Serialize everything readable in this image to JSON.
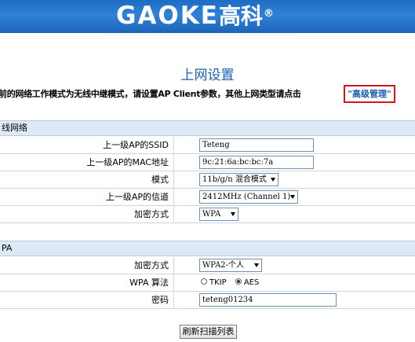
{
  "header": {
    "logo_text": "GAOKE",
    "logo_cn": "高科",
    "logo_mark": "®"
  },
  "page": {
    "title": "上网设置",
    "notice": "前的网络工作模式为无线中继模式，请设置AP Client参数，其他上网类型请点击",
    "advanced_link": "\"高级管理\""
  },
  "section_wireless": {
    "title": "线网络",
    "rows": {
      "ssid": {
        "label": "上一级AP的SSID",
        "value": "Teteng"
      },
      "mac": {
        "label": "上一级AP的MAC地址",
        "value": "9c:21:6a:bc:bc:7a"
      },
      "mode": {
        "label": "模式",
        "value": "11b/g/n 混合模式"
      },
      "channel": {
        "label": "上一级AP的信道",
        "value": "2412MHz (Channel 1)"
      },
      "encrypt": {
        "label": "加密方式",
        "value": "WPA"
      }
    }
  },
  "section_wpa": {
    "title": "PA",
    "rows": {
      "encrypt": {
        "label": "加密方式",
        "value": "WPA2-个人"
      },
      "algorithm": {
        "label": "WPA 算法",
        "options": [
          "TKIP",
          "AES"
        ],
        "selected": "AES"
      },
      "password": {
        "label": "密码",
        "value": "teteng01234"
      }
    }
  },
  "buttons": {
    "refresh": "刷新扫描列表"
  }
}
